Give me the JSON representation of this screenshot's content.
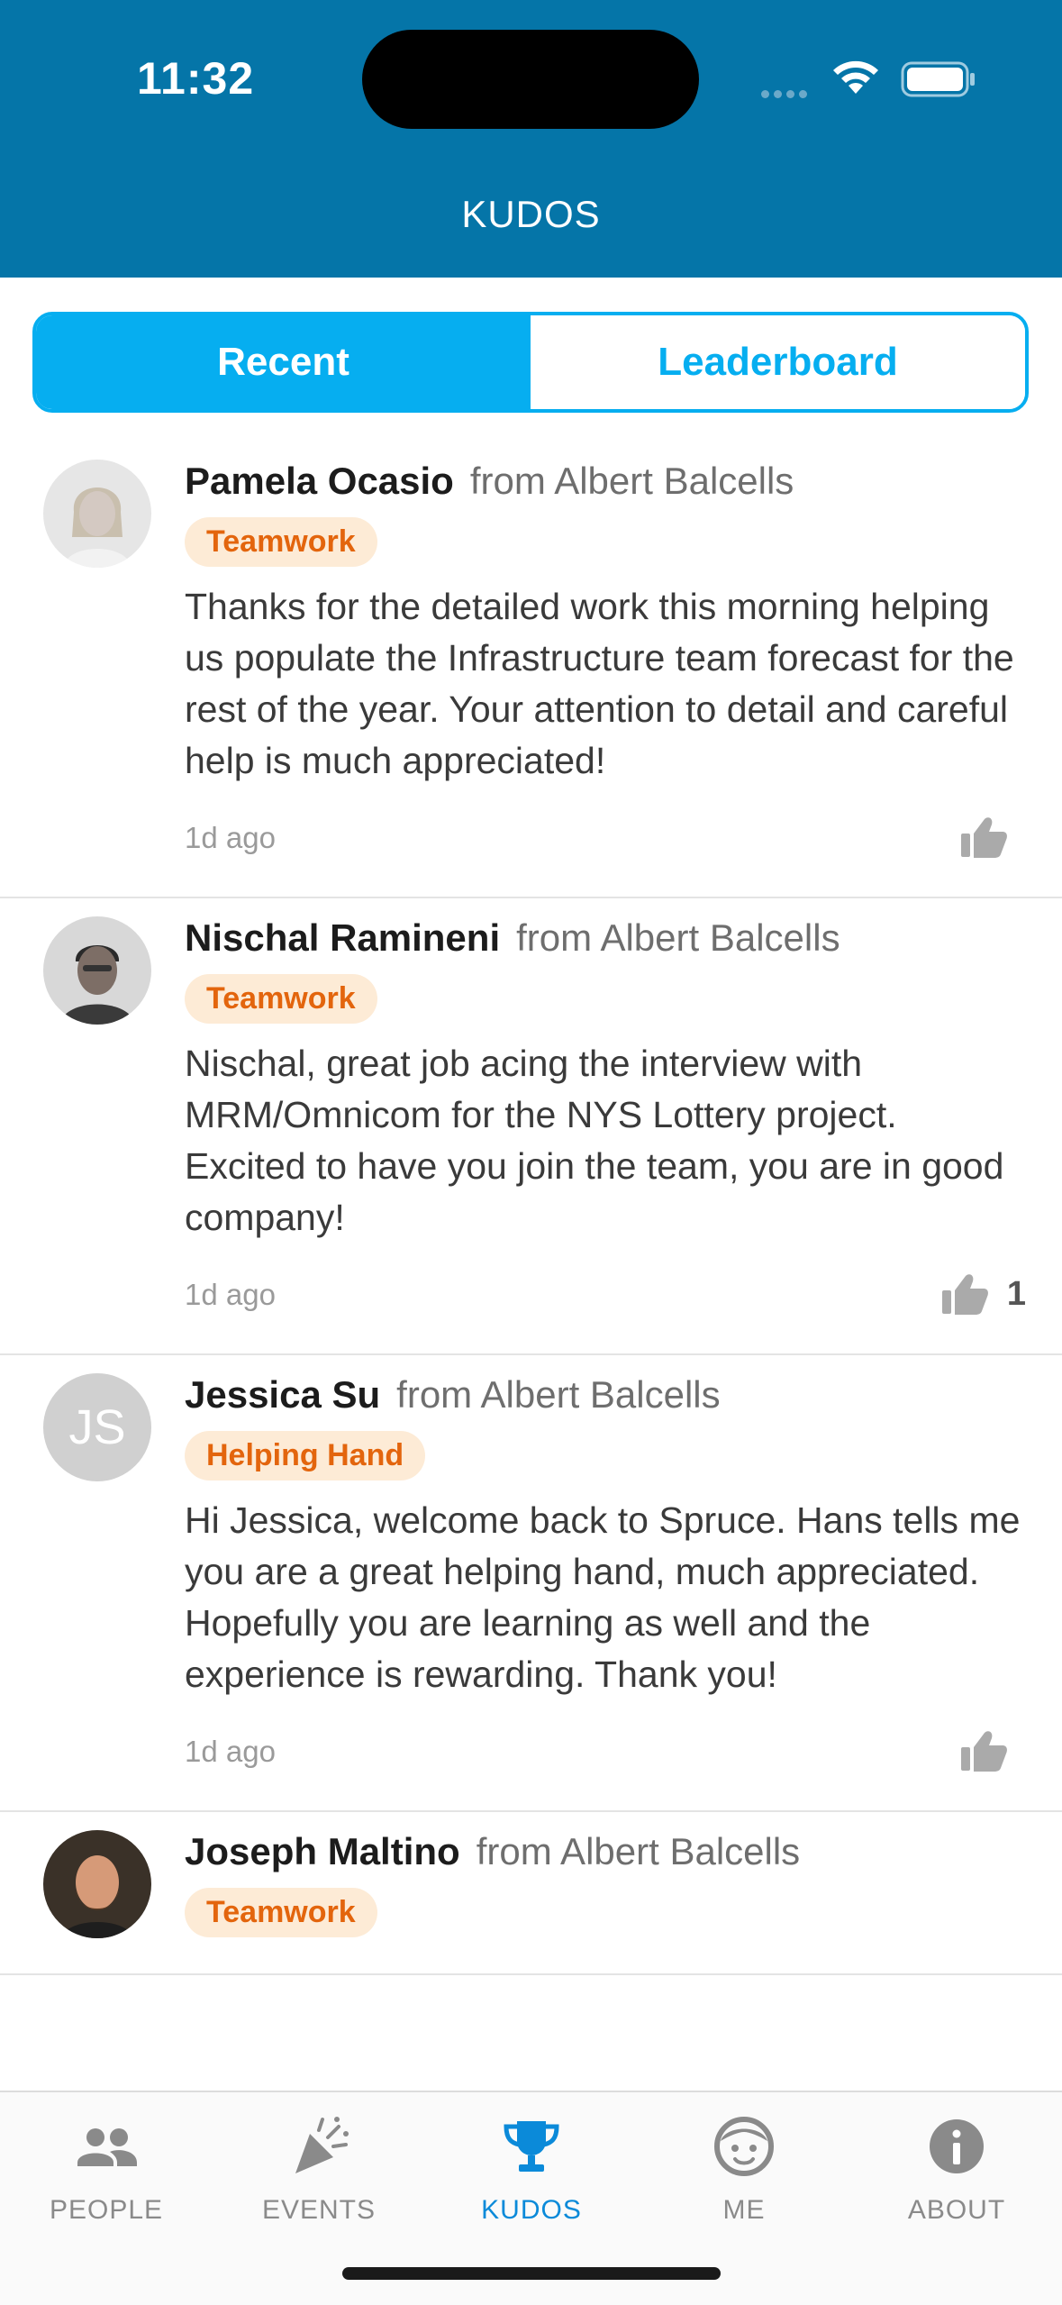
{
  "status": {
    "time": "11:32"
  },
  "nav": {
    "title": "KUDOS"
  },
  "segments": {
    "recent": "Recent",
    "leaderboard": "Leaderboard"
  },
  "kudos": [
    {
      "name": "Pamela Ocasio",
      "from": "from Albert Balcells",
      "badge": "Teamwork",
      "message": "Thanks for the detailed work this morning helping us populate the Infrastructure team forecast for the rest of the year. Your attention to detail and careful help is much appreciated!",
      "time": "1d ago",
      "likes": ""
    },
    {
      "name": "Nischal Ramineni",
      "from": "from Albert Balcells",
      "badge": "Teamwork",
      "message": "Nischal, great job acing the interview with MRM/Omnicom for the NYS Lottery project. Excited to have you join the team, you are in good company!",
      "time": "1d ago",
      "likes": "1"
    },
    {
      "name": "Jessica Su",
      "initials": "JS",
      "from": "from Albert Balcells",
      "badge": "Helping Hand",
      "message": "Hi Jessica, welcome back to Spruce. Hans tells me you are a great helping hand, much appreciated. Hopefully you are learning as well and the experience is rewarding. Thank you!",
      "time": "1d ago",
      "likes": ""
    },
    {
      "name": "Joseph Maltino",
      "from": "from Albert Balcells",
      "badge": "Teamwork"
    }
  ],
  "tabs": {
    "people": "PEOPLE",
    "events": "EVENTS",
    "kudos": "KUDOS",
    "me": "ME",
    "about": "ABOUT"
  },
  "colors": {
    "header": "#0575a8",
    "accent": "#06aef0",
    "badge_text": "#e3650d",
    "badge_bg": "#fdebd6",
    "tab_active": "#0b8ad9"
  }
}
